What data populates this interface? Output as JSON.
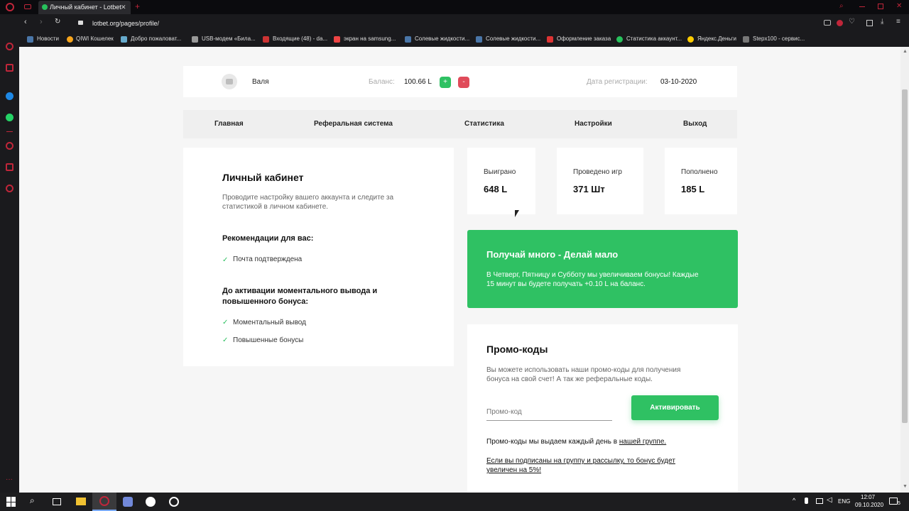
{
  "browser": {
    "tab_title": "Личный кабинет - Lotbet",
    "url": "lotbet.org/pages/profile/",
    "bookmarks": [
      "Новости",
      "QIWI Кошелек",
      "Добро пожаловат...",
      "USB-модем «Била...",
      "Входящие (48) - da...",
      "экран на samsung...",
      "Солевые жидкости...",
      "Солевые жидкости...",
      "Оформление заказа",
      "Статистика аккаунт...",
      "Яндекс.Деньги",
      "Stepx100 - сервис..."
    ]
  },
  "profile": {
    "name": "Валя",
    "balance_label": "Баланс:",
    "balance_value": "100.66 L",
    "plus": "+",
    "minus": "-",
    "reg_label": "Дата регистрации:",
    "reg_value": "03-10-2020"
  },
  "nav": [
    "Главная",
    "Реферальная система",
    "Статистика",
    "Настройки",
    "Выход"
  ],
  "cabinet": {
    "title": "Личный кабинет",
    "desc1": "Проводите настройку вашего аккаунта и следите за",
    "desc2": "статистикой в личном кабинете.",
    "rec_title": "Рекомендации для вас:",
    "rec_item": "Почта подтверждена",
    "act_title1": "До активации моментального вывода и",
    "act_title2": "повышенного бонуса:",
    "act_items": [
      "Моментальный вывод",
      "Повышенные бонусы"
    ]
  },
  "stats": [
    {
      "label": "Выиграно",
      "value": "648 L"
    },
    {
      "label": "Проведено игр",
      "value": "371 Шт"
    },
    {
      "label": "Пополнено",
      "value": "185 L"
    }
  ],
  "promo_banner": {
    "title": "Получай много - Делай мало",
    "text1": "В Четверг, Пятницу и Субботу мы увеличиваем бонусы! Каждые",
    "text2": "15 минут вы будете получать +0.10 L на баланс."
  },
  "promo": {
    "title": "Промо-коды",
    "desc1": "Вы можете использовать наши промо-коды для получения",
    "desc2": "бонуса на свой счет! А так же реферальные коды.",
    "placeholder": "Промо-код",
    "button": "Активировать",
    "note_prefix": "Промо-коды мы выдаем каждый день в ",
    "note_link": "нашей группе.",
    "sub_a": "Если вы подписаны на ",
    "sub_b": "группу",
    "sub_c": " и ",
    "sub_d": "рассылку",
    "sub_e": ", то бонус будет",
    "sub_f": "увеличен на 5%!"
  },
  "taskbar": {
    "lang": "ENG",
    "time": "12:07",
    "date": "09.10.2020",
    "notif": "5"
  },
  "colors": {
    "green": "#2fc163",
    "red": "#e04b5a",
    "accent": "#c0263a"
  }
}
